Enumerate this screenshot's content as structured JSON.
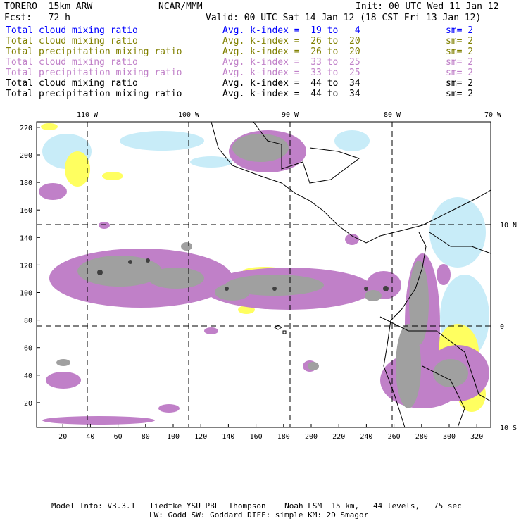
{
  "header": {
    "model": "TORERO  15km ARW",
    "org": "NCAR/MMM",
    "init": "Init: 00 UTC Wed 11 Jan 12",
    "fcst": "Fcst:   72 h",
    "valid": "Valid: 00 UTC Sat 14 Jan 12 (18 CST Fri 13 Jan 12)"
  },
  "legend": [
    {
      "field": "Total cloud mixing ratio",
      "range": "Avg. k-index =  19 to   4",
      "sm": "sm= 2",
      "color": "#0000ff"
    },
    {
      "field": "Total cloud mixing ratio",
      "range": "Avg. k-index =  26 to  20",
      "sm": "sm= 2",
      "color": "#808000"
    },
    {
      "field": "Total precipitation mixing ratio",
      "range": "Avg. k-index =  26 to  20",
      "sm": "sm= 2",
      "color": "#808000"
    },
    {
      "field": "Total cloud mixing ratio",
      "range": "Avg. k-index =  33 to  25",
      "sm": "sm= 2",
      "color": "#c080c8"
    },
    {
      "field": "Total precipitation mixing ratio",
      "range": "Avg. k-index =  33 to  25",
      "sm": "sm= 2",
      "color": "#c080c8"
    },
    {
      "field": "Total cloud mixing ratio",
      "range": "Avg. k-index =  44 to  34",
      "sm": "sm= 2",
      "color": "#000000"
    },
    {
      "field": "Total precipitation mixing ratio",
      "range": "Avg. k-index =  44 to  34",
      "sm": "sm= 2",
      "color": "#000000"
    }
  ],
  "axes": {
    "lon_labels": [
      "110 W",
      "100 W",
      "90 W",
      "80 W",
      "70 W"
    ],
    "lat_labels": [
      "10 N",
      "0",
      "10 S"
    ],
    "x_ticks": [
      "20",
      "40",
      "60",
      "80",
      "100",
      "120",
      "140",
      "160",
      "180",
      "200",
      "220",
      "240",
      "260",
      "280",
      "300",
      "320"
    ],
    "y_ticks": [
      "220",
      "200",
      "180",
      "160",
      "140",
      "120",
      "100",
      "80",
      "60",
      "40",
      "20"
    ]
  },
  "colors": {
    "cloud_light": "#c8ecf8",
    "yellow": "#ffff60",
    "magenta": "#c080c8",
    "gray": "#a0a0a0",
    "dark": "#404040"
  },
  "footer": {
    "line1": "Model Info: V3.3.1   Tiedtke YSU PBL  Thompson    Noah LSM  15 km,   44 levels,   75 sec",
    "line2": "LW: Godd SW: Goddard DIFF: simple KM: 2D Smagor"
  }
}
